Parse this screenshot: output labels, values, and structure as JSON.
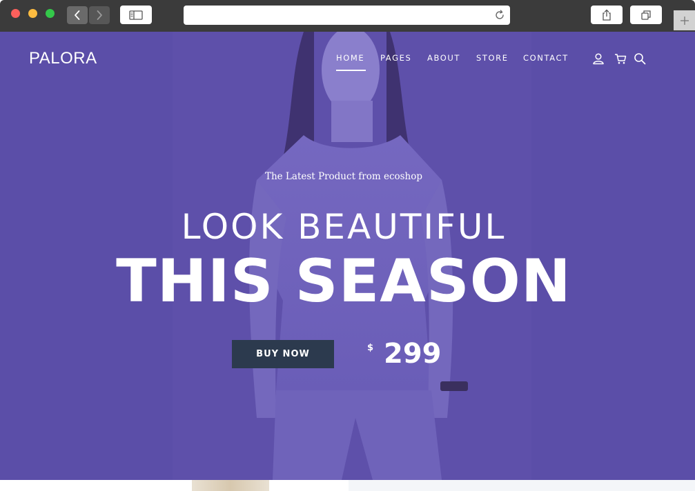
{
  "browser": {
    "address": {
      "value": "",
      "placeholder": ""
    },
    "icons": [
      "close-icon",
      "minimize-icon",
      "maximize-icon",
      "chevron-left-icon",
      "chevron-right-icon",
      "sidebar-icon",
      "reload-icon",
      "share-icon",
      "tabs-icon",
      "plus-icon"
    ]
  },
  "site": {
    "logo": "PALORA",
    "nav": [
      {
        "label": "HOME",
        "active": true
      },
      {
        "label": "PAGES",
        "active": false
      },
      {
        "label": "ABOUT",
        "active": false
      },
      {
        "label": "STORE",
        "active": false
      },
      {
        "label": "CONTACT",
        "active": false
      }
    ],
    "header_icons": [
      "user-icon",
      "cart-icon",
      "search-icon"
    ]
  },
  "hero": {
    "tagline": "The Latest Product from ecoshop",
    "headline_line1": "LOOK BEAUTIFUL",
    "headline_line2": "THIS SEASON",
    "cta_label": "BUY NOW",
    "price_currency": "$",
    "price_amount": "299"
  },
  "colors": {
    "hero_overlay": "#5b4ea8",
    "cta_background": "#2c3a4e",
    "chrome_background": "#3b3b3b",
    "text": "#ffffff"
  }
}
